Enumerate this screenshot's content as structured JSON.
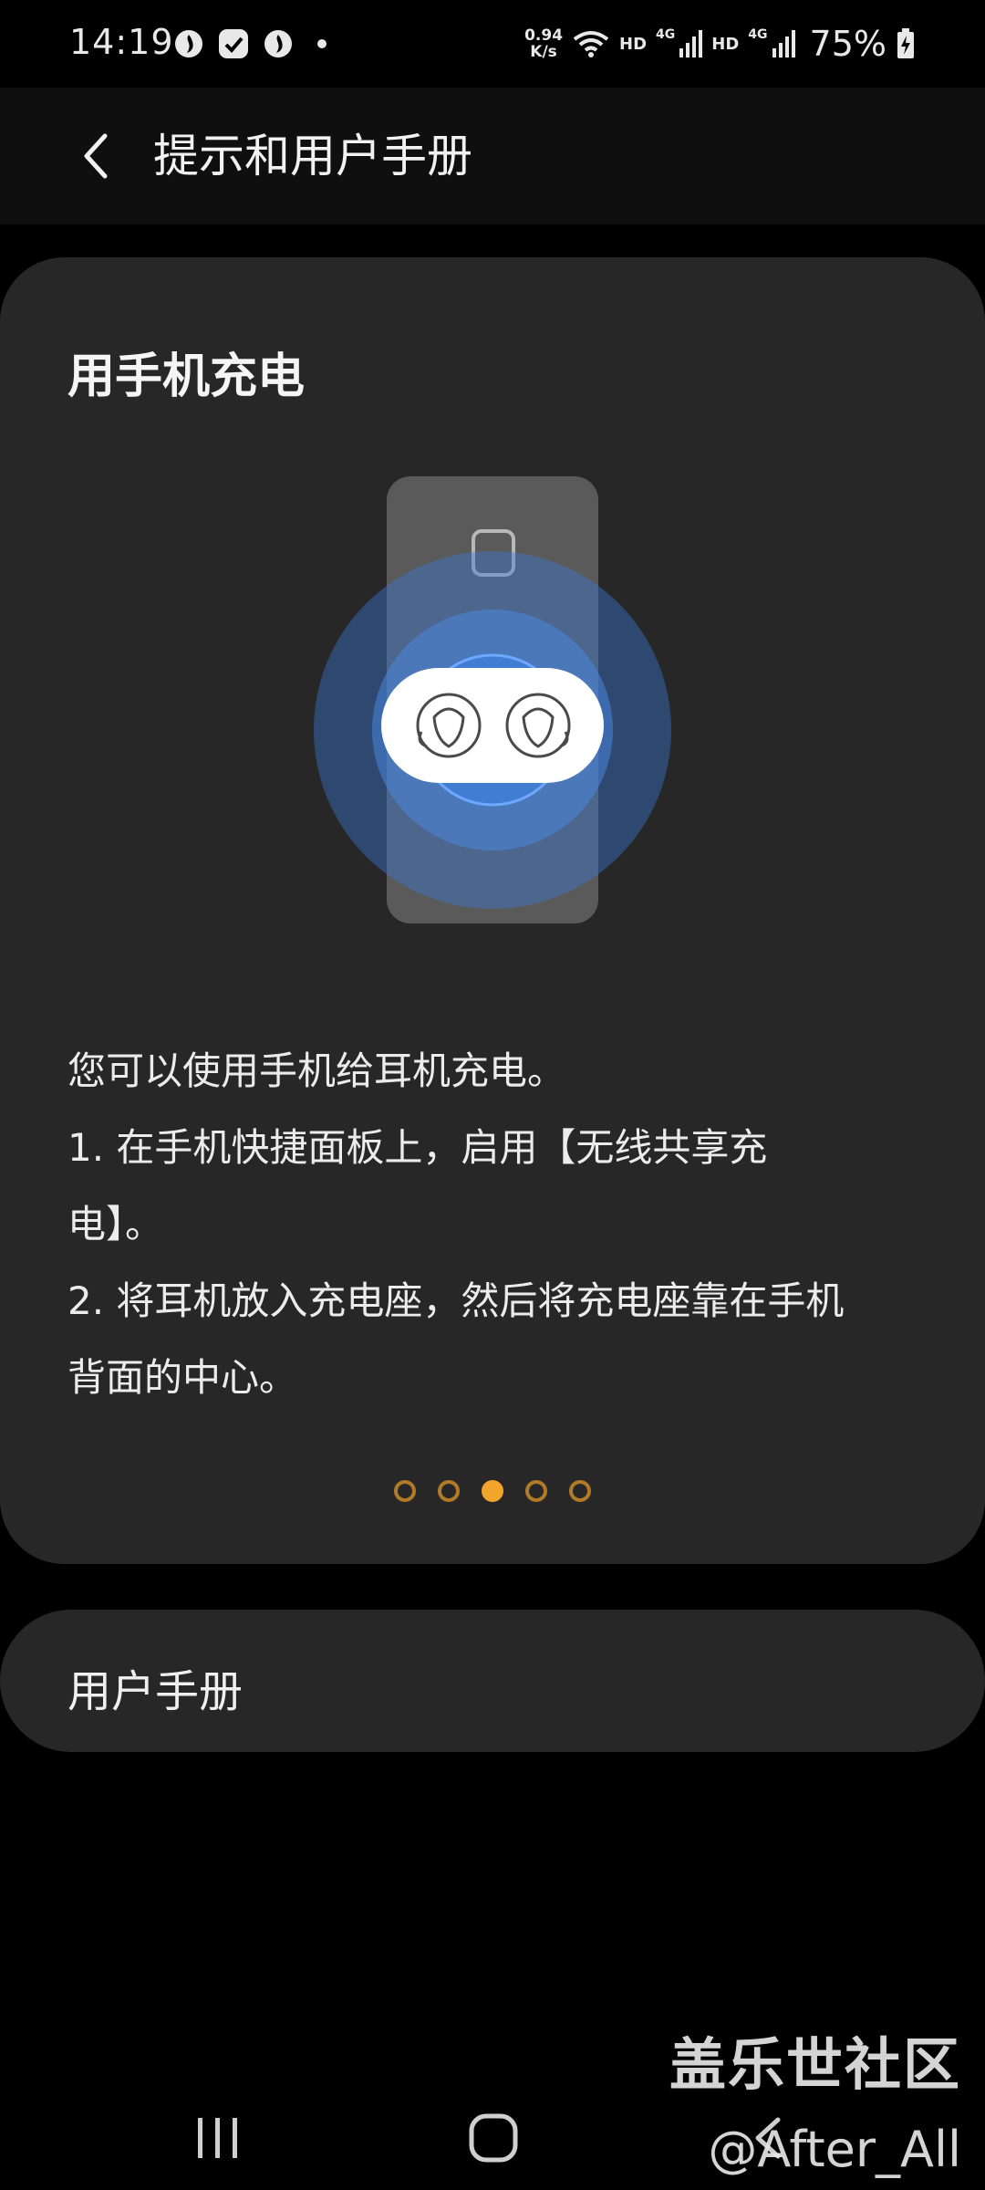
{
  "status_bar": {
    "time": "14:19",
    "speed_value": "0.94",
    "speed_unit": "K/s",
    "hd1": "HD",
    "net1": "4G",
    "hd2": "HD",
    "net2": "4G",
    "battery": "75%"
  },
  "header": {
    "title": "提示和用户手册"
  },
  "card": {
    "title": "用手机充电",
    "description": [
      "您可以使用手机给耳机充电。",
      "1. 在手机快捷面板上，启用【无线共享充",
      "电】。",
      "2. 将耳机放入充电座，然后将充电座靠在手机",
      "背面的中心。"
    ],
    "pager": {
      "total": 5,
      "active_index": 2
    }
  },
  "manual": {
    "label": "用户手册"
  },
  "watermark": {
    "line1": "盖乐世社区",
    "line2": "@After_All"
  },
  "colors": {
    "card_bg": "#272727",
    "pager_active": "#f3a42a",
    "pager_inactive": "#b07a26",
    "wave_blue": "#3f7fd8"
  }
}
